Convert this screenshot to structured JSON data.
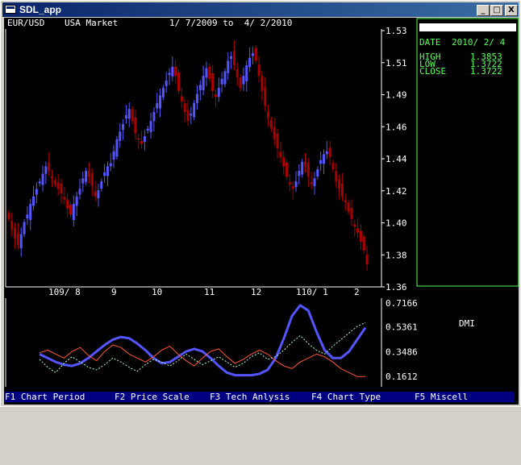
{
  "window": {
    "title": "SDL_app",
    "controls": {
      "minimize": "_",
      "maximize": "□",
      "close": "X"
    }
  },
  "chart_header": {
    "symbol": "EUR/USD",
    "market": "USA Market",
    "period": "1/ 7/2009 to  4/ 2/2010"
  },
  "info_panel": {
    "date_label": "DATE",
    "date_value": "2010/ 2/ 4",
    "high_label": "HIGH",
    "high_value": "1.3853",
    "low_label": "LOW",
    "low_value": "1.3722",
    "close_label": "CLOSE",
    "close_value": "1.3722"
  },
  "indicator": {
    "label": "DMI"
  },
  "function_keys": [
    {
      "key": "F1",
      "label": "F1 Chart Period"
    },
    {
      "key": "F2",
      "label": "F2 Price Scale"
    },
    {
      "key": "F3",
      "label": "F3 Tech Anlysis"
    },
    {
      "key": "F4",
      "label": "F4 Chart Type"
    },
    {
      "key": "F5",
      "label": "F5 Miscell"
    }
  ],
  "colors": {
    "up_candle": "#5555ff",
    "down_candle": "#aa0000",
    "panel_border": "#55ff55",
    "axis_text": "#ffffff",
    "info_text": "#55ff55",
    "dmi_adx": "#5555ff",
    "dmi_plus": "#ff5533",
    "dmi_minus": "#aaffcc",
    "status_bar_bg": "#000080"
  },
  "chart_data": [
    {
      "type": "candlestick",
      "title": "EUR/USD  USA Market  1/ 7/2009 to  4/ 2/2010",
      "x_tick_labels": [
        "109/ 8",
        "9",
        "10",
        "11",
        "12",
        "110/ 1",
        "2"
      ],
      "y_tick_labels": [
        "1.53",
        "1.51",
        "1.49",
        "1.46",
        "1.44",
        "1.42",
        "1.40",
        "1.38",
        "1.36"
      ],
      "ylim": [
        1.36,
        1.53
      ],
      "close": [
        1.405,
        1.398,
        1.392,
        1.388,
        1.395,
        1.403,
        1.408,
        1.415,
        1.42,
        1.425,
        1.43,
        1.435,
        1.44,
        1.437,
        1.432,
        1.428,
        1.425,
        1.422,
        1.418,
        1.412,
        1.408,
        1.415,
        1.42,
        1.425,
        1.432,
        1.437,
        1.433,
        1.427,
        1.42,
        1.424,
        1.43,
        1.436,
        1.44,
        1.442,
        1.45,
        1.458,
        1.463,
        1.468,
        1.474,
        1.478,
        1.47,
        1.462,
        1.458,
        1.455,
        1.46,
        1.465,
        1.47,
        1.476,
        1.482,
        1.487,
        1.492,
        1.497,
        1.502,
        1.506,
        1.5,
        1.49,
        1.483,
        1.476,
        1.47,
        1.475,
        1.482,
        1.488,
        1.494,
        1.5,
        1.505,
        1.498,
        1.49,
        1.486,
        1.492,
        1.498,
        1.503,
        1.51,
        1.513,
        1.507,
        1.499,
        1.492,
        1.5,
        1.507,
        1.512,
        1.515,
        1.51,
        1.5,
        1.49,
        1.48,
        1.472,
        1.465,
        1.458,
        1.452,
        1.446,
        1.44,
        1.433,
        1.428,
        1.425,
        1.43,
        1.437,
        1.443,
        1.44,
        1.433,
        1.428,
        1.432,
        1.438,
        1.444,
        1.448,
        1.45,
        1.446,
        1.438,
        1.43,
        1.425,
        1.42,
        1.416,
        1.41,
        1.405,
        1.4,
        1.396,
        1.39,
        1.384,
        1.375
      ]
    },
    {
      "type": "line",
      "title": "DMI",
      "y_tick_labels": [
        "0.7166",
        "0.5361",
        "0.3486",
        "0.1612"
      ],
      "series": [
        {
          "values": [
            0.33,
            0.3,
            0.27,
            0.25,
            0.24,
            0.26,
            0.3,
            0.35,
            0.4,
            0.44,
            0.46,
            0.45,
            0.41,
            0.36,
            0.3,
            0.26,
            0.27,
            0.31,
            0.35,
            0.37,
            0.35,
            0.3,
            0.24,
            0.19,
            0.17,
            0.17,
            0.17,
            0.18,
            0.21,
            0.3,
            0.45,
            0.62,
            0.7,
            0.66,
            0.5,
            0.36,
            0.3,
            0.3,
            0.35,
            0.44,
            0.53
          ]
        },
        {
          "values": [
            0.34,
            0.36,
            0.33,
            0.3,
            0.35,
            0.38,
            0.32,
            0.28,
            0.35,
            0.4,
            0.38,
            0.33,
            0.3,
            0.27,
            0.31,
            0.36,
            0.39,
            0.33,
            0.28,
            0.24,
            0.3,
            0.35,
            0.37,
            0.31,
            0.26,
            0.29,
            0.33,
            0.36,
            0.33,
            0.28,
            0.24,
            0.22,
            0.27,
            0.3,
            0.33,
            0.31,
            0.27,
            0.22,
            0.19,
            0.16,
            0.16
          ]
        },
        {
          "values": [
            0.29,
            0.23,
            0.19,
            0.26,
            0.31,
            0.27,
            0.23,
            0.21,
            0.25,
            0.3,
            0.27,
            0.23,
            0.2,
            0.25,
            0.29,
            0.27,
            0.24,
            0.28,
            0.33,
            0.29,
            0.25,
            0.28,
            0.31,
            0.27,
            0.23,
            0.26,
            0.31,
            0.34,
            0.29,
            0.31,
            0.36,
            0.42,
            0.47,
            0.41,
            0.36,
            0.33,
            0.39,
            0.44,
            0.49,
            0.54,
            0.57
          ]
        }
      ]
    }
  ]
}
